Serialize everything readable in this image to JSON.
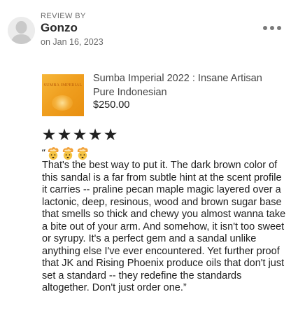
{
  "review_header": {
    "label": "REVIEW BY",
    "reviewer_name": "Gonzo",
    "date": "on Jan 16, 2023"
  },
  "icons": {
    "avatar": "person-silhouette-icon",
    "more": "more-options-icon",
    "star": "star-icon",
    "emoji": "exploding-head-emoji"
  },
  "product": {
    "title": "Sumba Imperial 2022 : Insane Artisan Pure Indonesian",
    "price": "$250.00",
    "thumbnail_text": "SUMBA IMPERIAL"
  },
  "rating": {
    "stars": 5,
    "max": 5
  },
  "review": {
    "open_quote": "“",
    "emoji_count": 3,
    "body": "That's the best way to put it. The dark brown color of this sandal is a far from subtle hint at the scent profile it carries -- praline pecan maple magic layered over a lactonic, deep, resinous, wood and brown sugar base that smells so thick and chewy you almost wanna take a bite out of your arm. And somehow, it isn't too sweet or syrupy. It's a perfect gem and a sandal unlike anything else I've ever encountered. Yet further proof that JK and Rising Phoenix produce oils that don't just set a standard -- they redefine the standards altogether. Don't just order one.”"
  },
  "colors": {
    "thumbnail": "#f0a020",
    "muted_text": "#6b6b6b",
    "stars": "#222222"
  }
}
